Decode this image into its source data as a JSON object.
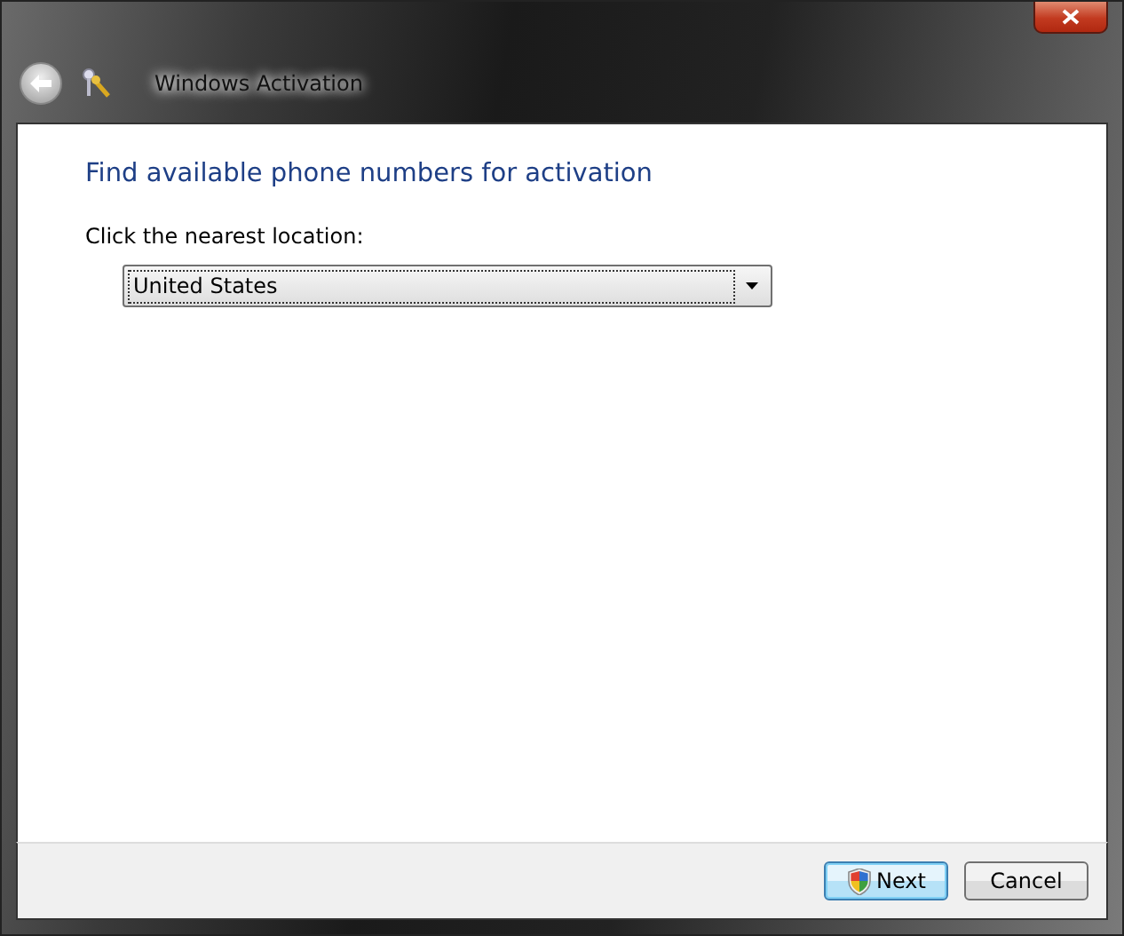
{
  "window": {
    "title": "Windows Activation"
  },
  "heading": "Find available phone numbers for activation",
  "location": {
    "label": "Click the nearest location:",
    "value": "United States"
  },
  "buttons": [
    {
      "label": "Next",
      "kind": "shield",
      "default": true
    },
    {
      "label": "Cancel",
      "kind": "plain",
      "default": false
    }
  ]
}
